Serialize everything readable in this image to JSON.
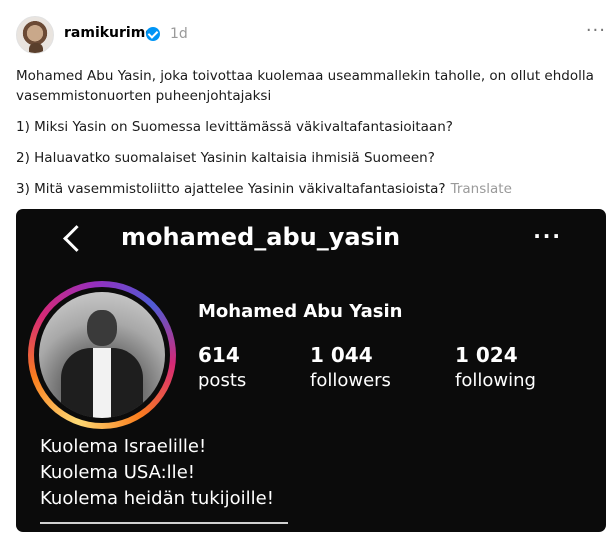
{
  "post": {
    "username": "ramikurimo",
    "timestamp": "1d",
    "paragraphs": [
      "Mohamed Abu Yasin, joka toivottaa kuolemaa useammallekin taholle, on ollut ehdolla vasemmistonuorten puheenjohtajaksi",
      "1) Miksi Yasin on Suomessa levittämässä väkivaltafantasioitaan?",
      "2) Haluavatko suomalaiset Yasinin kaltaisia ihmisiä Suomeen?",
      "3) Mitä vasemmistoliitto ajattelee Yasinin väkivaltafantasioista?"
    ],
    "translate_label": "Translate"
  },
  "embedded_profile": {
    "handle": "mohamed_abu_yasin",
    "display_name": "Mohamed Abu Yasin",
    "stats": [
      {
        "value": "614",
        "label": "posts"
      },
      {
        "value": "1 044",
        "label": "followers"
      },
      {
        "value": "1 024",
        "label": "following"
      }
    ],
    "bio_lines": [
      "Kuolema Israelille!",
      "Kuolema USA:lle!",
      "Kuolema heidän tukijoille!"
    ]
  },
  "icons": {
    "verified": "verified-badge-icon",
    "more": "more-options-icon",
    "back": "back-arrow-icon"
  },
  "colors": {
    "verified_blue": "#0095f6",
    "muted_text": "#9a9a9a",
    "screenshot_bg": "#0b0b0b"
  }
}
